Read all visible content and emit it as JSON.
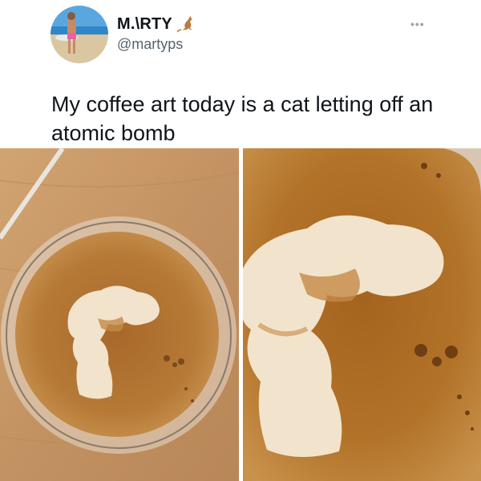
{
  "tweet": {
    "author": {
      "display_name": "M.\\RTY",
      "display_name_emoji_icon": "kangaroo-icon",
      "handle": "@martyps",
      "avatar_icon": "avatar-photo"
    },
    "more_icon": "more-options-icon",
    "text": "My coffee art today is a cat letting off an atomic bomb",
    "media": [
      {
        "kind": "photo",
        "subject": "latte-art-overhead"
      },
      {
        "kind": "photo",
        "subject": "latte-art-closeup"
      }
    ]
  },
  "colors": {
    "text_primary": "#0f1419",
    "text_secondary": "#536471",
    "coffee_crema": "#b07530",
    "foam": "#f3e7d4",
    "wood": "#c99a68"
  }
}
